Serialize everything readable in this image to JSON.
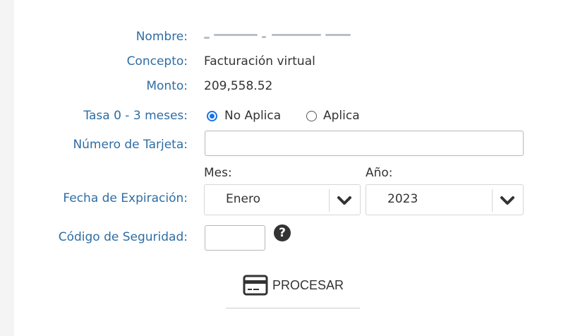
{
  "form": {
    "nombre_label": "Nombre:",
    "concepto_label": "Concepto:",
    "concepto_value": "Facturación virtual",
    "monto_label": "Monto:",
    "monto_value": "209,558.52",
    "tasa_label": "Tasa 0 - 3 meses:",
    "tasa_options": [
      {
        "label": "No Aplica",
        "selected": true
      },
      {
        "label": "Aplica",
        "selected": false
      }
    ],
    "tarjeta_label": "Número de Tarjeta:",
    "tarjeta_value": "",
    "mes_label": "Mes:",
    "anio_label": "Año:",
    "expiracion_label": "Fecha de Expiración:",
    "mes_value": "Enero",
    "anio_value": "2023",
    "seguridad_label": "Código de Seguridad:",
    "seguridad_value": "",
    "help_icon_glyph": "?",
    "procesar_label": "PROCESAR"
  },
  "colors": {
    "label": "#2e6da4",
    "text": "#333333",
    "radio_selected": "#1a73e8"
  }
}
